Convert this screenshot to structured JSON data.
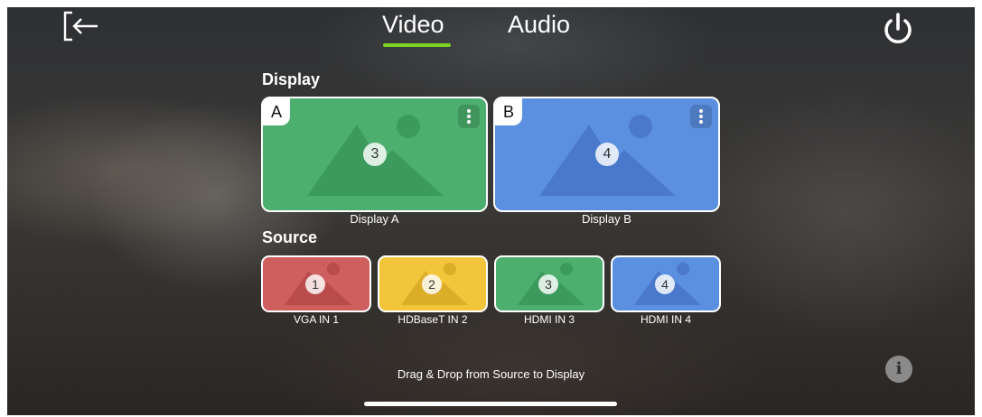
{
  "tabs": [
    {
      "label": "Video",
      "active": true
    },
    {
      "label": "Audio",
      "active": false
    }
  ],
  "header": {
    "exit_icon": "exit-icon",
    "power_icon": "power-icon"
  },
  "accent_color": "#7dd321",
  "display": {
    "label": "Display",
    "cards": [
      {
        "tag": "A",
        "source_number": "3",
        "caption": "Display A",
        "color": "#4caf6e",
        "menu_icon": "kebab-menu-icon"
      },
      {
        "tag": "B",
        "source_number": "4",
        "caption": "Display B",
        "color": "#5b8fe0",
        "menu_icon": "kebab-menu-icon"
      }
    ]
  },
  "source": {
    "label": "Source",
    "cards": [
      {
        "number": "1",
        "caption": "VGA IN 1",
        "color": "#cf5f5f"
      },
      {
        "number": "2",
        "caption": "HDBaseT IN 2",
        "color": "#f3c53a"
      },
      {
        "number": "3",
        "caption": "HDMI IN 3",
        "color": "#4caf6e"
      },
      {
        "number": "4",
        "caption": "HDMI IN 4",
        "color": "#5b8fe0"
      }
    ]
  },
  "hint": "Drag & Drop from Source to Display",
  "info_icon": "info-icon"
}
